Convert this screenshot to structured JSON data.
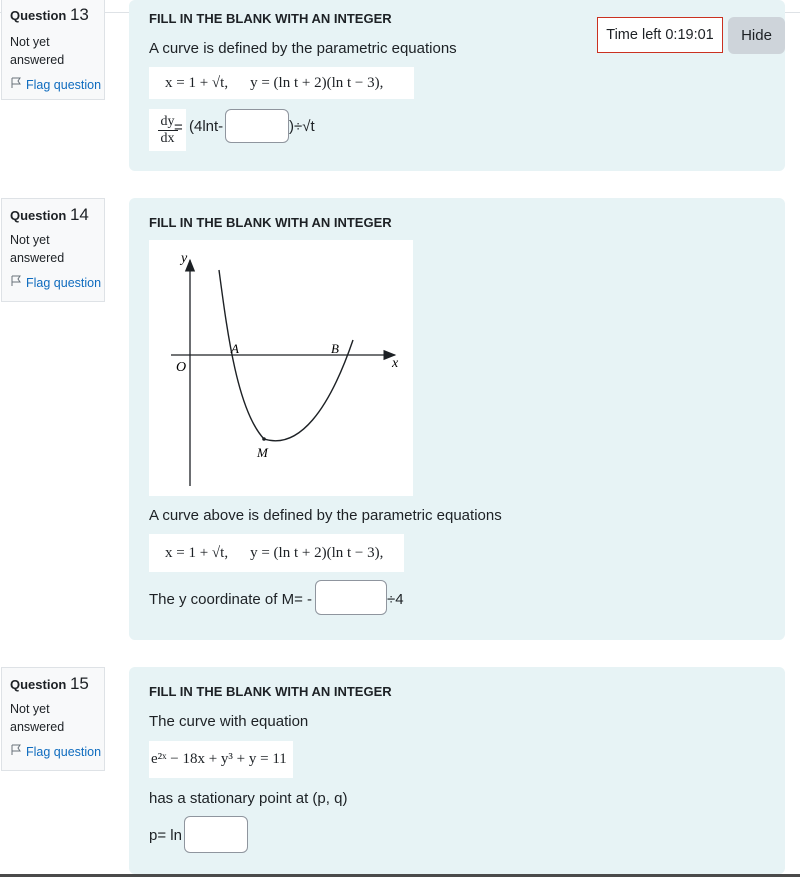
{
  "timer": {
    "label": "Time left 0:19:01",
    "hide_label": "Hide"
  },
  "questions": [
    {
      "label": "Question",
      "number": "13",
      "state": "Not yet answered",
      "flag": "Flag question",
      "type": "FILL IN THE BLANK WITH AN INTEGER",
      "intro": "A curve is defined by the parametric equations",
      "eq_x": "x = 1 + √t,",
      "eq_y": "y = (ln t + 2)(ln t − 3),",
      "deriv_num": "dy",
      "deriv_den": "dx",
      "deriv_eq": "=",
      "prefix": "(4lnt-",
      "suffix": ")÷√t"
    },
    {
      "label": "Question",
      "number": "14",
      "state": "Not yet answered",
      "flag": "Flag question",
      "type": "FILL IN THE BLANK WITH AN INTEGER",
      "graph": {
        "y": "y",
        "x": "x",
        "o": "O",
        "a": "A",
        "b": "B",
        "m": "M"
      },
      "intro": "A curve above is defined by the parametric equations",
      "eq_x": "x = 1 + √t,",
      "eq_y": "y = (ln t + 2)(ln t − 3),",
      "prefix": "The y coordinate of M= -",
      "suffix": "÷4"
    },
    {
      "label": "Question",
      "number": "15",
      "state": "Not yet answered",
      "flag": "Flag question",
      "type": "FILL IN THE BLANK WITH AN INTEGER",
      "intro": "The curve with equation",
      "equation": "e²ˣ − 18x + y³ + y = 11",
      "stationary": "has a stationary point at (p, q)",
      "prefix": "p= ln"
    }
  ]
}
